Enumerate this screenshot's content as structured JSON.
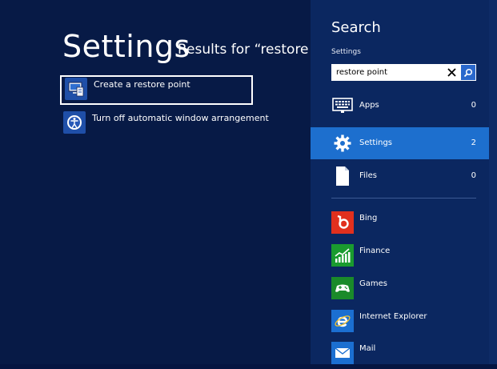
{
  "results": {
    "title": "Settings",
    "subtitle": "Results for “restore pc",
    "items": [
      {
        "label": "Create a restore point"
      },
      {
        "label": "Turn off automatic window arrangement"
      }
    ]
  },
  "search_pane": {
    "title": "Search",
    "scope": "Settings",
    "query": "restore point",
    "categories": [
      {
        "label": "Apps",
        "count": "0",
        "icon": "apps-icon"
      },
      {
        "label": "Settings",
        "count": "2",
        "icon": "gear-icon",
        "selected": true
      },
      {
        "label": "Files",
        "count": "0",
        "icon": "file-icon"
      }
    ],
    "apps": [
      {
        "label": "Bing",
        "icon": "bing-icon",
        "color": "#e1301e"
      },
      {
        "label": "Finance",
        "icon": "finance-icon",
        "color": "#1a9b2f"
      },
      {
        "label": "Games",
        "icon": "games-icon",
        "color": "#1a8a2a"
      },
      {
        "label": "Internet Explorer",
        "icon": "internet-explorer-icon",
        "color": "#1b6fd1"
      },
      {
        "label": "Mail",
        "icon": "mail-icon",
        "color": "#1b6fd1"
      }
    ]
  },
  "colors": {
    "background": "#051541",
    "pane": "#0b2760",
    "accent": "#1d6fce"
  }
}
